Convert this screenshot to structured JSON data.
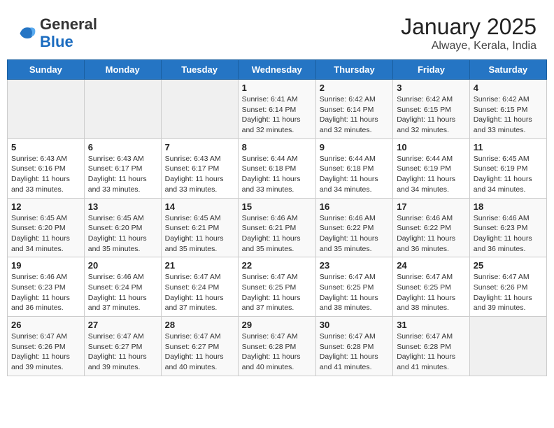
{
  "header": {
    "logo_general": "General",
    "logo_blue": "Blue",
    "title": "January 2025",
    "subtitle": "Alwaye, Kerala, India"
  },
  "days_of_week": [
    "Sunday",
    "Monday",
    "Tuesday",
    "Wednesday",
    "Thursday",
    "Friday",
    "Saturday"
  ],
  "weeks": [
    [
      {
        "day": "",
        "info": ""
      },
      {
        "day": "",
        "info": ""
      },
      {
        "day": "",
        "info": ""
      },
      {
        "day": "1",
        "info": "Sunrise: 6:41 AM\nSunset: 6:14 PM\nDaylight: 11 hours\nand 32 minutes."
      },
      {
        "day": "2",
        "info": "Sunrise: 6:42 AM\nSunset: 6:14 PM\nDaylight: 11 hours\nand 32 minutes."
      },
      {
        "day": "3",
        "info": "Sunrise: 6:42 AM\nSunset: 6:15 PM\nDaylight: 11 hours\nand 32 minutes."
      },
      {
        "day": "4",
        "info": "Sunrise: 6:42 AM\nSunset: 6:15 PM\nDaylight: 11 hours\nand 33 minutes."
      }
    ],
    [
      {
        "day": "5",
        "info": "Sunrise: 6:43 AM\nSunset: 6:16 PM\nDaylight: 11 hours\nand 33 minutes."
      },
      {
        "day": "6",
        "info": "Sunrise: 6:43 AM\nSunset: 6:17 PM\nDaylight: 11 hours\nand 33 minutes."
      },
      {
        "day": "7",
        "info": "Sunrise: 6:43 AM\nSunset: 6:17 PM\nDaylight: 11 hours\nand 33 minutes."
      },
      {
        "day": "8",
        "info": "Sunrise: 6:44 AM\nSunset: 6:18 PM\nDaylight: 11 hours\nand 33 minutes."
      },
      {
        "day": "9",
        "info": "Sunrise: 6:44 AM\nSunset: 6:18 PM\nDaylight: 11 hours\nand 34 minutes."
      },
      {
        "day": "10",
        "info": "Sunrise: 6:44 AM\nSunset: 6:19 PM\nDaylight: 11 hours\nand 34 minutes."
      },
      {
        "day": "11",
        "info": "Sunrise: 6:45 AM\nSunset: 6:19 PM\nDaylight: 11 hours\nand 34 minutes."
      }
    ],
    [
      {
        "day": "12",
        "info": "Sunrise: 6:45 AM\nSunset: 6:20 PM\nDaylight: 11 hours\nand 34 minutes."
      },
      {
        "day": "13",
        "info": "Sunrise: 6:45 AM\nSunset: 6:20 PM\nDaylight: 11 hours\nand 35 minutes."
      },
      {
        "day": "14",
        "info": "Sunrise: 6:45 AM\nSunset: 6:21 PM\nDaylight: 11 hours\nand 35 minutes."
      },
      {
        "day": "15",
        "info": "Sunrise: 6:46 AM\nSunset: 6:21 PM\nDaylight: 11 hours\nand 35 minutes."
      },
      {
        "day": "16",
        "info": "Sunrise: 6:46 AM\nSunset: 6:22 PM\nDaylight: 11 hours\nand 35 minutes."
      },
      {
        "day": "17",
        "info": "Sunrise: 6:46 AM\nSunset: 6:22 PM\nDaylight: 11 hours\nand 36 minutes."
      },
      {
        "day": "18",
        "info": "Sunrise: 6:46 AM\nSunset: 6:23 PM\nDaylight: 11 hours\nand 36 minutes."
      }
    ],
    [
      {
        "day": "19",
        "info": "Sunrise: 6:46 AM\nSunset: 6:23 PM\nDaylight: 11 hours\nand 36 minutes."
      },
      {
        "day": "20",
        "info": "Sunrise: 6:46 AM\nSunset: 6:24 PM\nDaylight: 11 hours\nand 37 minutes."
      },
      {
        "day": "21",
        "info": "Sunrise: 6:47 AM\nSunset: 6:24 PM\nDaylight: 11 hours\nand 37 minutes."
      },
      {
        "day": "22",
        "info": "Sunrise: 6:47 AM\nSunset: 6:25 PM\nDaylight: 11 hours\nand 37 minutes."
      },
      {
        "day": "23",
        "info": "Sunrise: 6:47 AM\nSunset: 6:25 PM\nDaylight: 11 hours\nand 38 minutes."
      },
      {
        "day": "24",
        "info": "Sunrise: 6:47 AM\nSunset: 6:25 PM\nDaylight: 11 hours\nand 38 minutes."
      },
      {
        "day": "25",
        "info": "Sunrise: 6:47 AM\nSunset: 6:26 PM\nDaylight: 11 hours\nand 39 minutes."
      }
    ],
    [
      {
        "day": "26",
        "info": "Sunrise: 6:47 AM\nSunset: 6:26 PM\nDaylight: 11 hours\nand 39 minutes."
      },
      {
        "day": "27",
        "info": "Sunrise: 6:47 AM\nSunset: 6:27 PM\nDaylight: 11 hours\nand 39 minutes."
      },
      {
        "day": "28",
        "info": "Sunrise: 6:47 AM\nSunset: 6:27 PM\nDaylight: 11 hours\nand 40 minutes."
      },
      {
        "day": "29",
        "info": "Sunrise: 6:47 AM\nSunset: 6:28 PM\nDaylight: 11 hours\nand 40 minutes."
      },
      {
        "day": "30",
        "info": "Sunrise: 6:47 AM\nSunset: 6:28 PM\nDaylight: 11 hours\nand 41 minutes."
      },
      {
        "day": "31",
        "info": "Sunrise: 6:47 AM\nSunset: 6:28 PM\nDaylight: 11 hours\nand 41 minutes."
      },
      {
        "day": "",
        "info": ""
      }
    ]
  ]
}
